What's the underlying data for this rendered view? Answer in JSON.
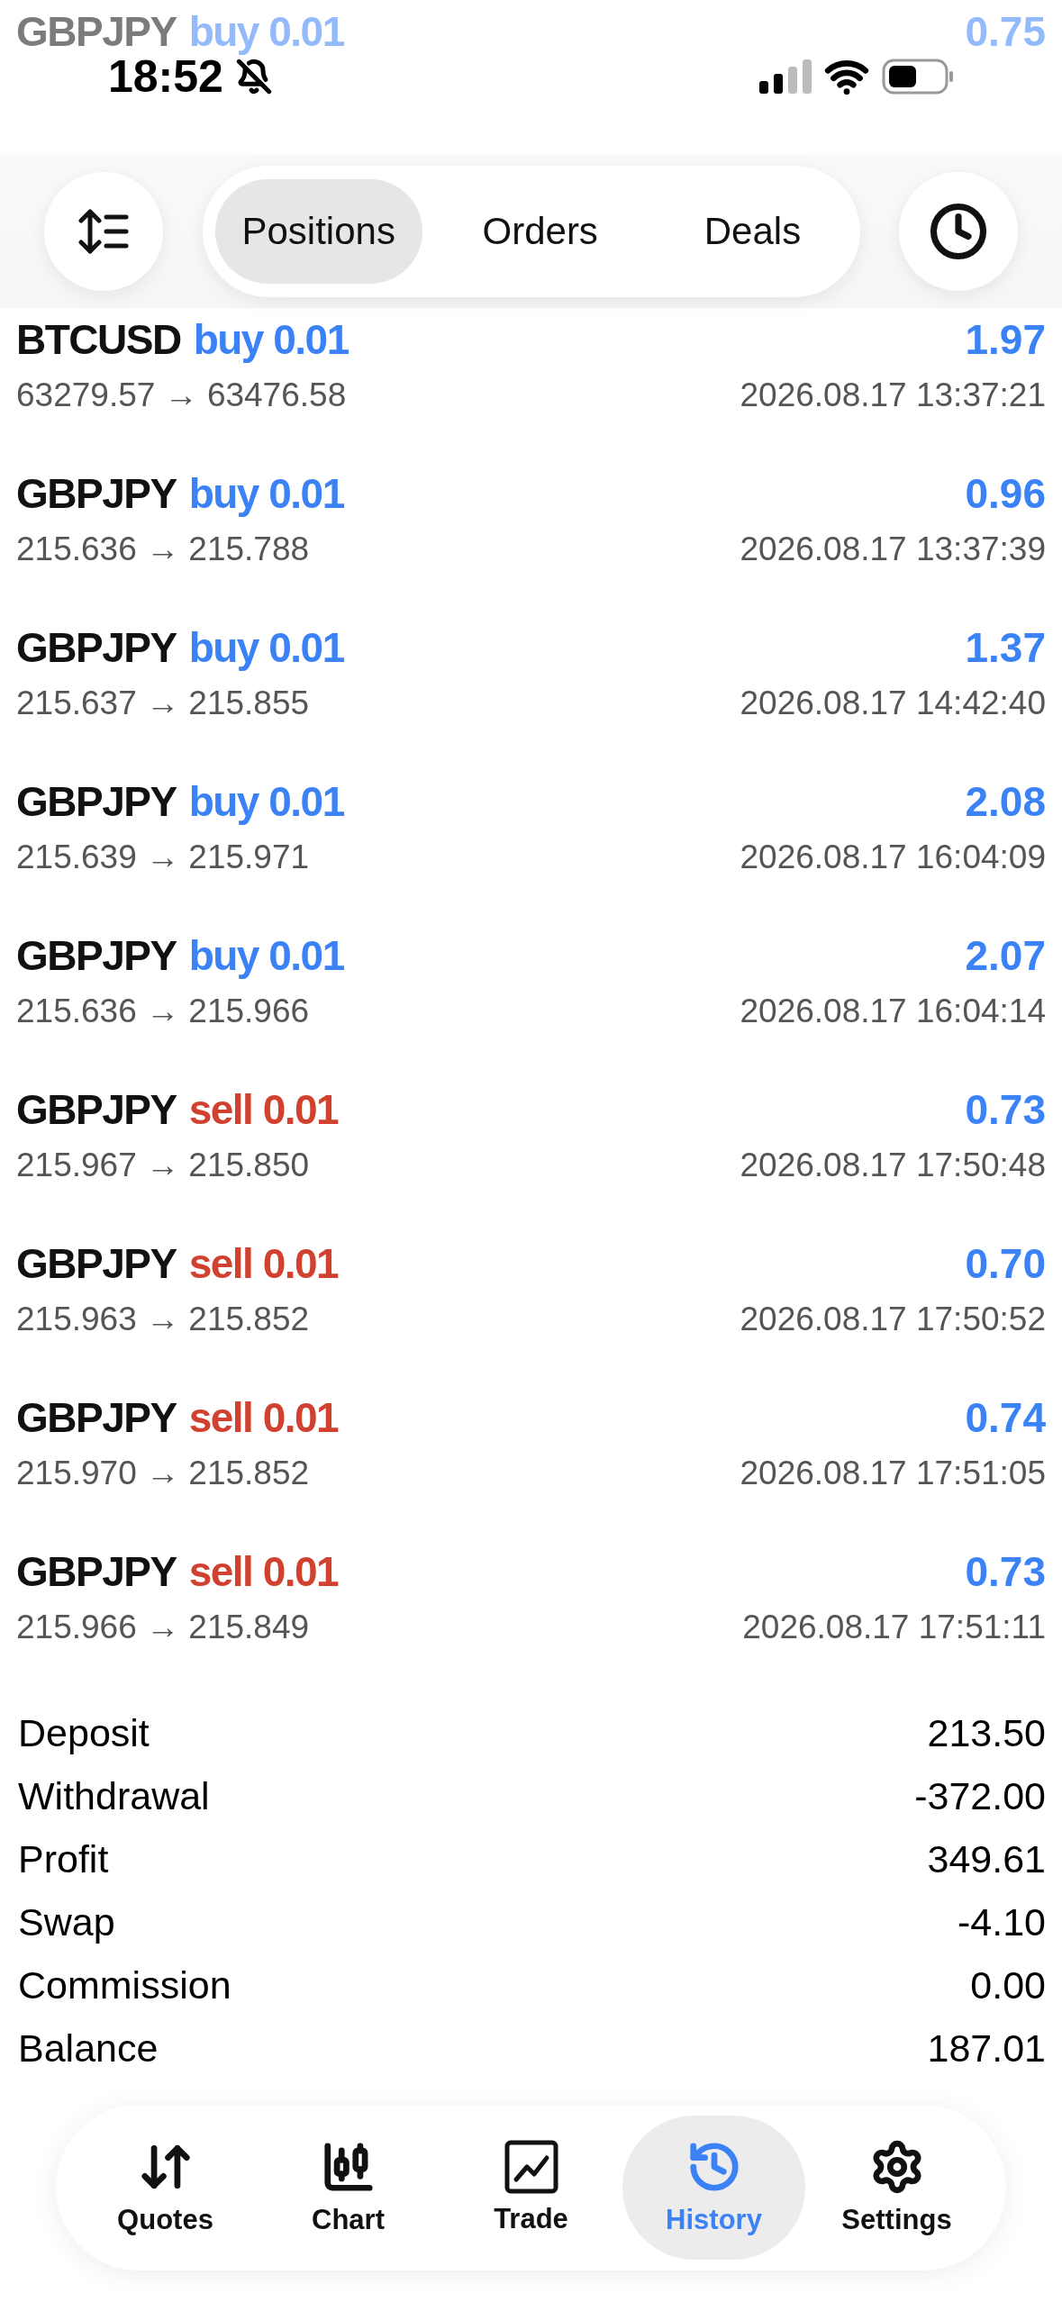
{
  "status_bar": {
    "time": "18:52"
  },
  "toolbar": {
    "tabs": [
      {
        "label": "Positions",
        "selected": true
      },
      {
        "label": "Orders",
        "selected": false
      },
      {
        "label": "Deals",
        "selected": false
      }
    ]
  },
  "deals": [
    {
      "symbol": "GBPJPY",
      "trade": "buy 0.01",
      "kind": "buy",
      "profit": "0.75",
      "dimmed": true
    },
    {
      "symbol": "BTCUSD",
      "trade": "buy 0.01",
      "kind": "buy",
      "profit": "1.97",
      "prices": "63279.57 → 63476.58",
      "time": "2026.08.17 13:37:21",
      "dimmed": false
    },
    {
      "symbol": "GBPJPY",
      "trade": "buy 0.01",
      "kind": "buy",
      "profit": "0.96",
      "prices": "215.636 → 215.788",
      "time": "2026.08.17 13:37:39",
      "dimmed": false
    },
    {
      "symbol": "GBPJPY",
      "trade": "buy 0.01",
      "kind": "buy",
      "profit": "1.37",
      "prices": "215.637 → 215.855",
      "time": "2026.08.17 14:42:40",
      "dimmed": false
    },
    {
      "symbol": "GBPJPY",
      "trade": "buy 0.01",
      "kind": "buy",
      "profit": "2.08",
      "prices": "215.639 → 215.971",
      "time": "2026.08.17 16:04:09",
      "dimmed": false
    },
    {
      "symbol": "GBPJPY",
      "trade": "buy 0.01",
      "kind": "buy",
      "profit": "2.07",
      "prices": "215.636 → 215.966",
      "time": "2026.08.17 16:04:14",
      "dimmed": false
    },
    {
      "symbol": "GBPJPY",
      "trade": "sell 0.01",
      "kind": "sell",
      "profit": "0.73",
      "prices": "215.967 → 215.850",
      "time": "2026.08.17 17:50:48",
      "dimmed": false
    },
    {
      "symbol": "GBPJPY",
      "trade": "sell 0.01",
      "kind": "sell",
      "profit": "0.70",
      "prices": "215.963 → 215.852",
      "time": "2026.08.17 17:50:52",
      "dimmed": false
    },
    {
      "symbol": "GBPJPY",
      "trade": "sell 0.01",
      "kind": "sell",
      "profit": "0.74",
      "prices": "215.970 → 215.852",
      "time": "2026.08.17 17:51:05",
      "dimmed": false
    },
    {
      "symbol": "GBPJPY",
      "trade": "sell 0.01",
      "kind": "sell",
      "profit": "0.73",
      "prices": "215.966 → 215.849",
      "time": "2026.08.17 17:51:11",
      "dimmed": false
    }
  ],
  "summary": [
    {
      "label": "Deposit",
      "value": "213.50"
    },
    {
      "label": "Withdrawal",
      "value": "-372.00"
    },
    {
      "label": "Profit",
      "value": "349.61"
    },
    {
      "label": "Swap",
      "value": "-4.10"
    },
    {
      "label": "Commission",
      "value": "0.00"
    },
    {
      "label": "Balance",
      "value": "187.01"
    }
  ],
  "nav": [
    {
      "label": "Quotes",
      "kind": "quotes",
      "selected": false
    },
    {
      "label": "Chart",
      "kind": "chart",
      "selected": false
    },
    {
      "label": "Trade",
      "kind": "trade",
      "selected": false
    },
    {
      "label": "History",
      "kind": "history",
      "selected": true
    },
    {
      "label": "Settings",
      "kind": "settings",
      "selected": false
    }
  ]
}
